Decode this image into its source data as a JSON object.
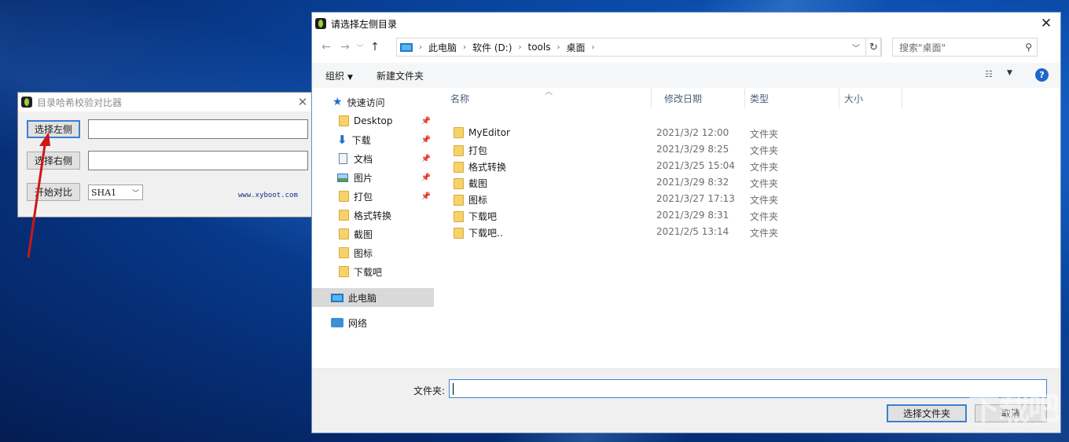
{
  "app": {
    "title": "目录哈希校验对比器",
    "btn_left": "选择左侧",
    "btn_right": "选择右侧",
    "btn_compare": "开始对比",
    "algo_selected": "SHA1",
    "link": "www.xyboot.com"
  },
  "dialog": {
    "title": "请选择左侧目录",
    "breadcrumb": [
      "此电脑",
      "软件 (D:)",
      "tools",
      "桌面"
    ],
    "search_placeholder": "搜索\"桌面\"",
    "toolbar": {
      "organize": "组织",
      "new_folder": "新建文件夹"
    },
    "tree": {
      "quick_access": "快速访问",
      "items": [
        "Desktop",
        "下载",
        "文档",
        "图片",
        "打包",
        "格式转换",
        "截图",
        "图标",
        "下载吧"
      ],
      "this_pc": "此电脑",
      "network": "网络"
    },
    "columns": {
      "name": "名称",
      "date": "修改日期",
      "type": "类型",
      "size": "大小"
    },
    "files": [
      {
        "name": "MyEditor",
        "date": "2021/3/2 12:00",
        "type": "文件夹"
      },
      {
        "name": "打包",
        "date": "2021/3/29 8:25",
        "type": "文件夹"
      },
      {
        "name": "格式转换",
        "date": "2021/3/25 15:04",
        "type": "文件夹"
      },
      {
        "name": "截图",
        "date": "2021/3/29 8:32",
        "type": "文件夹"
      },
      {
        "name": "图标",
        "date": "2021/3/27 17:13",
        "type": "文件夹"
      },
      {
        "name": "下载吧",
        "date": "2021/3/29 8:31",
        "type": "文件夹"
      },
      {
        "name": "下载吧..",
        "date": "2021/2/5 13:14",
        "type": "文件夹"
      }
    ],
    "folder_label": "文件夹:",
    "folder_value": "",
    "btn_select": "选择文件夹",
    "btn_cancel": "取消"
  },
  "watermark": {
    "main": "下载吧",
    "sub": "www.xiazaiba.com"
  },
  "colors": {
    "accent": "#3c7fd1",
    "folder": "#f6d36a",
    "help": "#1f67c9"
  }
}
